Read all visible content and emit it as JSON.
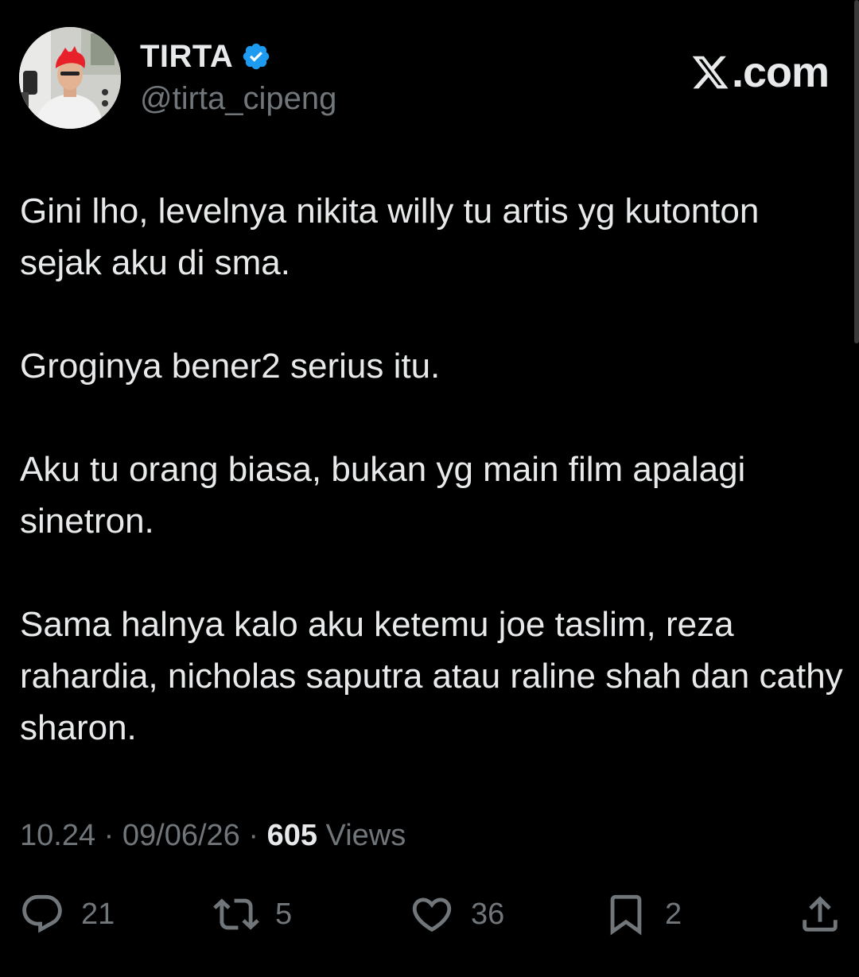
{
  "author": {
    "name": "TIRTA",
    "handle": "@tirta_cipeng",
    "verified": true
  },
  "brand": {
    "label": ".com",
    "icon": "x-logo-icon"
  },
  "tweet": {
    "paragraphs": [
      "Gini lho, levelnya nikita willy tu artis yg kutonton sejak aku di sma.",
      "Groginya bener2 serius itu.",
      "Aku tu orang biasa, bukan yg main film apalagi sinetron.",
      "Sama halnya kalo aku ketemu joe taslim, reza rahardia, nicholas saputra atau raline shah dan cathy sharon."
    ]
  },
  "meta": {
    "time": "10.24",
    "separator": "·",
    "date": "09/06/26",
    "views_count": "605",
    "views_label": "Views"
  },
  "actions": {
    "replies": {
      "count": "21",
      "icon": "reply-icon"
    },
    "reposts": {
      "count": "5",
      "icon": "repost-icon"
    },
    "likes": {
      "count": "36",
      "icon": "heart-icon"
    },
    "bookmarks": {
      "count": "2",
      "icon": "bookmark-icon"
    },
    "share": {
      "icon": "share-icon"
    }
  },
  "colors": {
    "background": "#000000",
    "text": "#e7e9ea",
    "muted": "#71767b",
    "verified_blue": "#1d9bf0",
    "avatar_hair": "#e8202a"
  }
}
